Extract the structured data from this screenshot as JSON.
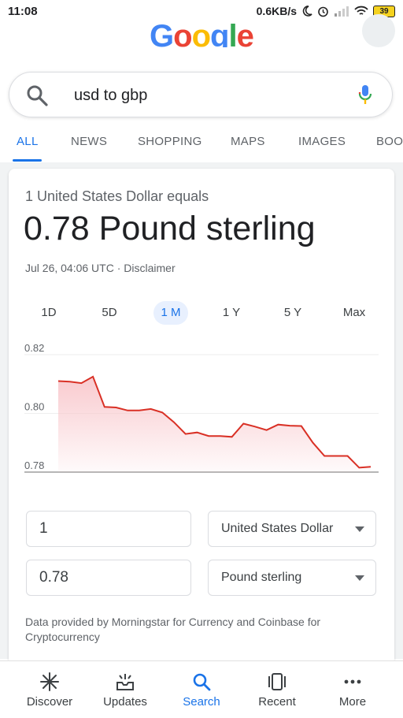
{
  "status": {
    "time": "11:08",
    "speed": "0.6KB/s",
    "battery": "39"
  },
  "search": {
    "query": "usd to gbp"
  },
  "tabs": [
    {
      "label": "ALL"
    },
    {
      "label": "NEWS"
    },
    {
      "label": "SHOPPING"
    },
    {
      "label": "MAPS"
    },
    {
      "label": "IMAGES"
    },
    {
      "label": "BOO"
    }
  ],
  "converter": {
    "equals": "1 United States Dollar equals",
    "result": "0.78 Pound sterling",
    "timestamp": "Jul 26, 04:06 UTC · Disclaimer",
    "ranges": [
      "1D",
      "5D",
      "1 M",
      "1 Y",
      "5 Y",
      "Max"
    ],
    "active_range": "1 M",
    "from_amount": "1",
    "from_currency": "United States Dollar",
    "to_amount": "0.78",
    "to_currency": "Pound sterling",
    "source": "Data provided by Morningstar for Currency and Coinbase for Cryptocurrency"
  },
  "chart_data": {
    "type": "area",
    "title": "",
    "xlabel": "",
    "ylabel": "",
    "ylim": [
      0.78,
      0.82
    ],
    "y_ticks": [
      "0.82",
      "0.80",
      "0.78"
    ],
    "grid": true,
    "series": [
      {
        "values": [
          0.811,
          0.8108,
          0.8103,
          0.8125,
          0.8022,
          0.802,
          0.801,
          0.801,
          0.8015,
          0.8003,
          0.797,
          0.793,
          0.7935,
          0.7923,
          0.7923,
          0.792,
          0.7965,
          0.7955,
          0.7943,
          0.7962,
          0.7958,
          0.7957,
          0.79,
          0.7855,
          0.7855,
          0.7855,
          0.7815,
          0.7818
        ]
      }
    ],
    "line_color": "#d93025",
    "fill_color": "#f8c4c9"
  },
  "nav": [
    {
      "label": "Discover",
      "icon": "asterisk-icon"
    },
    {
      "label": "Updates",
      "icon": "inbox-icon"
    },
    {
      "label": "Search",
      "icon": "search-icon"
    },
    {
      "label": "Recent",
      "icon": "tabs-icon"
    },
    {
      "label": "More",
      "icon": "dots-icon"
    }
  ]
}
